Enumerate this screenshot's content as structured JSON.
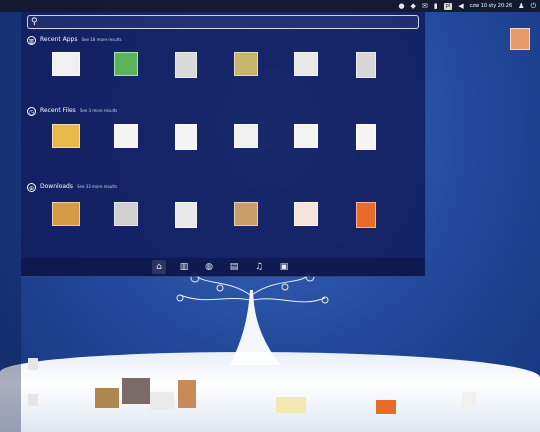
{
  "topbar": {
    "keyboard_layout": "pl",
    "clock": "czw 10 sty 20:26",
    "indicators": [
      "circle-icon",
      "dropbox-icon",
      "messaging-icon",
      "network-icon",
      "volume-icon",
      "user-icon",
      "power-icon"
    ]
  },
  "dash": {
    "search": {
      "value": "",
      "placeholder": ""
    },
    "sections": [
      {
        "title": "Recent Apps",
        "see_more": "See 18 more results",
        "icon": "apps-icon",
        "items": [
          {
            "label": "",
            "color": "#f0f0f0"
          },
          {
            "label": "",
            "color": "#5bb45c"
          },
          {
            "label": "",
            "color": "#d9d9d9"
          },
          {
            "label": "",
            "color": "#c6b56a"
          },
          {
            "label": "",
            "color": "#e8e8e8"
          },
          {
            "label": "",
            "color": "#d6d6d6"
          }
        ]
      },
      {
        "title": "Recent Files",
        "see_more": "See 3 more results",
        "icon": "clock-icon",
        "items": [
          {
            "label": "",
            "color": "#e8b84a"
          },
          {
            "label": "",
            "color": "#f4f4f4"
          },
          {
            "label": "",
            "color": "#f4f4f4"
          },
          {
            "label": "",
            "color": "#f0f0f0"
          },
          {
            "label": "",
            "color": "#f4f4f4"
          },
          {
            "label": "",
            "color": "#f4f4f4"
          }
        ]
      },
      {
        "title": "Downloads",
        "see_more": "See 33 more results",
        "icon": "download-icon",
        "items": [
          {
            "label": "",
            "color": "#d49a45"
          },
          {
            "label": "",
            "color": "#cfcfcf"
          },
          {
            "label": "",
            "color": "#e9e9e9"
          },
          {
            "label": "",
            "color": "#c99d6a"
          },
          {
            "label": "",
            "color": "#f3e3dc"
          },
          {
            "label": "",
            "color": "#e86b2a"
          }
        ]
      }
    ],
    "lenses": [
      {
        "name": "home-icon",
        "glyph": "⌂",
        "active": true
      },
      {
        "name": "applications-icon",
        "glyph": "▥",
        "active": false
      },
      {
        "name": "files-icon",
        "glyph": "◍",
        "active": false
      },
      {
        "name": "documents-icon",
        "glyph": "▤",
        "active": false
      },
      {
        "name": "music-icon",
        "glyph": "♫",
        "active": false
      },
      {
        "name": "video-icon",
        "glyph": "▣",
        "active": false
      }
    ]
  },
  "colors": {
    "panel": "#12162a",
    "dash": "#101a58",
    "wallpaper": "#21489a"
  }
}
